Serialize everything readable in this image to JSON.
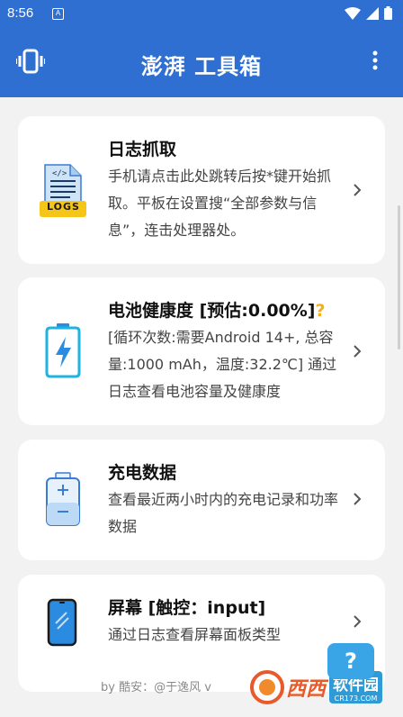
{
  "status_bar": {
    "time": "8:56",
    "notification_icon": "A"
  },
  "app_bar": {
    "title": "澎湃 工具箱",
    "left_icon": "vibration-icon",
    "right_icon": "more-vert-icon"
  },
  "cards": [
    {
      "title": "日志抓取",
      "desc": "手机请点击此处跳转后按*键开始抓取。平板在设置搜“全部参数与信息”，连击处理器处。",
      "icon_label": "LOGS"
    },
    {
      "title": "电池健康度 [预估:0.00%]",
      "badge": "?",
      "desc": "[循环次数:需要Android 14+, 总容量:1000 mAh，温度:32.2℃] 通过日志查看电池容量及健康度"
    },
    {
      "title": "充电数据",
      "desc": "查看最近两小时内的充电记录和功率数据"
    },
    {
      "title": "屏幕 [触控：input]",
      "desc": "通过日志查看屏幕面板类型"
    }
  ],
  "footer": {
    "text": "by 酷安：@于逸风 v"
  },
  "fab": {
    "label": "?"
  },
  "watermark": {
    "text_cn": "西西",
    "box_cn": "软件园",
    "box_url": "CR173.COM"
  },
  "colors": {
    "primary": "#2f6fd2",
    "fab": "#39a5e6",
    "background": "#f2f2f2",
    "card": "#ffffff"
  }
}
